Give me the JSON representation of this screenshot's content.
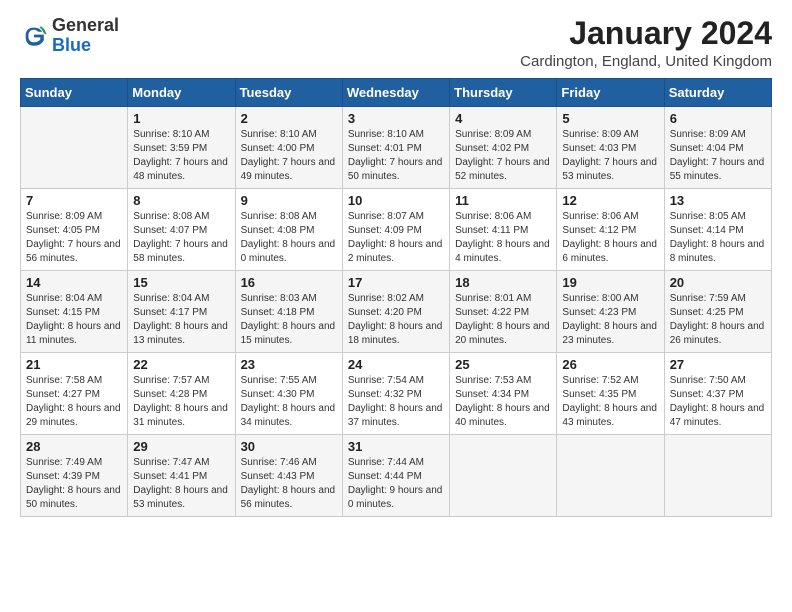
{
  "logo": {
    "general": "General",
    "blue": "Blue"
  },
  "header": {
    "month": "January 2024",
    "location": "Cardington, England, United Kingdom"
  },
  "days_of_week": [
    "Sunday",
    "Monday",
    "Tuesday",
    "Wednesday",
    "Thursday",
    "Friday",
    "Saturday"
  ],
  "weeks": [
    [
      {
        "day": "",
        "sunrise": "",
        "sunset": "",
        "daylight": ""
      },
      {
        "day": "1",
        "sunrise": "Sunrise: 8:10 AM",
        "sunset": "Sunset: 3:59 PM",
        "daylight": "Daylight: 7 hours and 48 minutes."
      },
      {
        "day": "2",
        "sunrise": "Sunrise: 8:10 AM",
        "sunset": "Sunset: 4:00 PM",
        "daylight": "Daylight: 7 hours and 49 minutes."
      },
      {
        "day": "3",
        "sunrise": "Sunrise: 8:10 AM",
        "sunset": "Sunset: 4:01 PM",
        "daylight": "Daylight: 7 hours and 50 minutes."
      },
      {
        "day": "4",
        "sunrise": "Sunrise: 8:09 AM",
        "sunset": "Sunset: 4:02 PM",
        "daylight": "Daylight: 7 hours and 52 minutes."
      },
      {
        "day": "5",
        "sunrise": "Sunrise: 8:09 AM",
        "sunset": "Sunset: 4:03 PM",
        "daylight": "Daylight: 7 hours and 53 minutes."
      },
      {
        "day": "6",
        "sunrise": "Sunrise: 8:09 AM",
        "sunset": "Sunset: 4:04 PM",
        "daylight": "Daylight: 7 hours and 55 minutes."
      }
    ],
    [
      {
        "day": "7",
        "sunrise": "Sunrise: 8:09 AM",
        "sunset": "Sunset: 4:05 PM",
        "daylight": "Daylight: 7 hours and 56 minutes."
      },
      {
        "day": "8",
        "sunrise": "Sunrise: 8:08 AM",
        "sunset": "Sunset: 4:07 PM",
        "daylight": "Daylight: 7 hours and 58 minutes."
      },
      {
        "day": "9",
        "sunrise": "Sunrise: 8:08 AM",
        "sunset": "Sunset: 4:08 PM",
        "daylight": "Daylight: 8 hours and 0 minutes."
      },
      {
        "day": "10",
        "sunrise": "Sunrise: 8:07 AM",
        "sunset": "Sunset: 4:09 PM",
        "daylight": "Daylight: 8 hours and 2 minutes."
      },
      {
        "day": "11",
        "sunrise": "Sunrise: 8:06 AM",
        "sunset": "Sunset: 4:11 PM",
        "daylight": "Daylight: 8 hours and 4 minutes."
      },
      {
        "day": "12",
        "sunrise": "Sunrise: 8:06 AM",
        "sunset": "Sunset: 4:12 PM",
        "daylight": "Daylight: 8 hours and 6 minutes."
      },
      {
        "day": "13",
        "sunrise": "Sunrise: 8:05 AM",
        "sunset": "Sunset: 4:14 PM",
        "daylight": "Daylight: 8 hours and 8 minutes."
      }
    ],
    [
      {
        "day": "14",
        "sunrise": "Sunrise: 8:04 AM",
        "sunset": "Sunset: 4:15 PM",
        "daylight": "Daylight: 8 hours and 11 minutes."
      },
      {
        "day": "15",
        "sunrise": "Sunrise: 8:04 AM",
        "sunset": "Sunset: 4:17 PM",
        "daylight": "Daylight: 8 hours and 13 minutes."
      },
      {
        "day": "16",
        "sunrise": "Sunrise: 8:03 AM",
        "sunset": "Sunset: 4:18 PM",
        "daylight": "Daylight: 8 hours and 15 minutes."
      },
      {
        "day": "17",
        "sunrise": "Sunrise: 8:02 AM",
        "sunset": "Sunset: 4:20 PM",
        "daylight": "Daylight: 8 hours and 18 minutes."
      },
      {
        "day": "18",
        "sunrise": "Sunrise: 8:01 AM",
        "sunset": "Sunset: 4:22 PM",
        "daylight": "Daylight: 8 hours and 20 minutes."
      },
      {
        "day": "19",
        "sunrise": "Sunrise: 8:00 AM",
        "sunset": "Sunset: 4:23 PM",
        "daylight": "Daylight: 8 hours and 23 minutes."
      },
      {
        "day": "20",
        "sunrise": "Sunrise: 7:59 AM",
        "sunset": "Sunset: 4:25 PM",
        "daylight": "Daylight: 8 hours and 26 minutes."
      }
    ],
    [
      {
        "day": "21",
        "sunrise": "Sunrise: 7:58 AM",
        "sunset": "Sunset: 4:27 PM",
        "daylight": "Daylight: 8 hours and 29 minutes."
      },
      {
        "day": "22",
        "sunrise": "Sunrise: 7:57 AM",
        "sunset": "Sunset: 4:28 PM",
        "daylight": "Daylight: 8 hours and 31 minutes."
      },
      {
        "day": "23",
        "sunrise": "Sunrise: 7:55 AM",
        "sunset": "Sunset: 4:30 PM",
        "daylight": "Daylight: 8 hours and 34 minutes."
      },
      {
        "day": "24",
        "sunrise": "Sunrise: 7:54 AM",
        "sunset": "Sunset: 4:32 PM",
        "daylight": "Daylight: 8 hours and 37 minutes."
      },
      {
        "day": "25",
        "sunrise": "Sunrise: 7:53 AM",
        "sunset": "Sunset: 4:34 PM",
        "daylight": "Daylight: 8 hours and 40 minutes."
      },
      {
        "day": "26",
        "sunrise": "Sunrise: 7:52 AM",
        "sunset": "Sunset: 4:35 PM",
        "daylight": "Daylight: 8 hours and 43 minutes."
      },
      {
        "day": "27",
        "sunrise": "Sunrise: 7:50 AM",
        "sunset": "Sunset: 4:37 PM",
        "daylight": "Daylight: 8 hours and 47 minutes."
      }
    ],
    [
      {
        "day": "28",
        "sunrise": "Sunrise: 7:49 AM",
        "sunset": "Sunset: 4:39 PM",
        "daylight": "Daylight: 8 hours and 50 minutes."
      },
      {
        "day": "29",
        "sunrise": "Sunrise: 7:47 AM",
        "sunset": "Sunset: 4:41 PM",
        "daylight": "Daylight: 8 hours and 53 minutes."
      },
      {
        "day": "30",
        "sunrise": "Sunrise: 7:46 AM",
        "sunset": "Sunset: 4:43 PM",
        "daylight": "Daylight: 8 hours and 56 minutes."
      },
      {
        "day": "31",
        "sunrise": "Sunrise: 7:44 AM",
        "sunset": "Sunset: 4:44 PM",
        "daylight": "Daylight: 9 hours and 0 minutes."
      },
      {
        "day": "",
        "sunrise": "",
        "sunset": "",
        "daylight": ""
      },
      {
        "day": "",
        "sunrise": "",
        "sunset": "",
        "daylight": ""
      },
      {
        "day": "",
        "sunrise": "",
        "sunset": "",
        "daylight": ""
      }
    ]
  ]
}
